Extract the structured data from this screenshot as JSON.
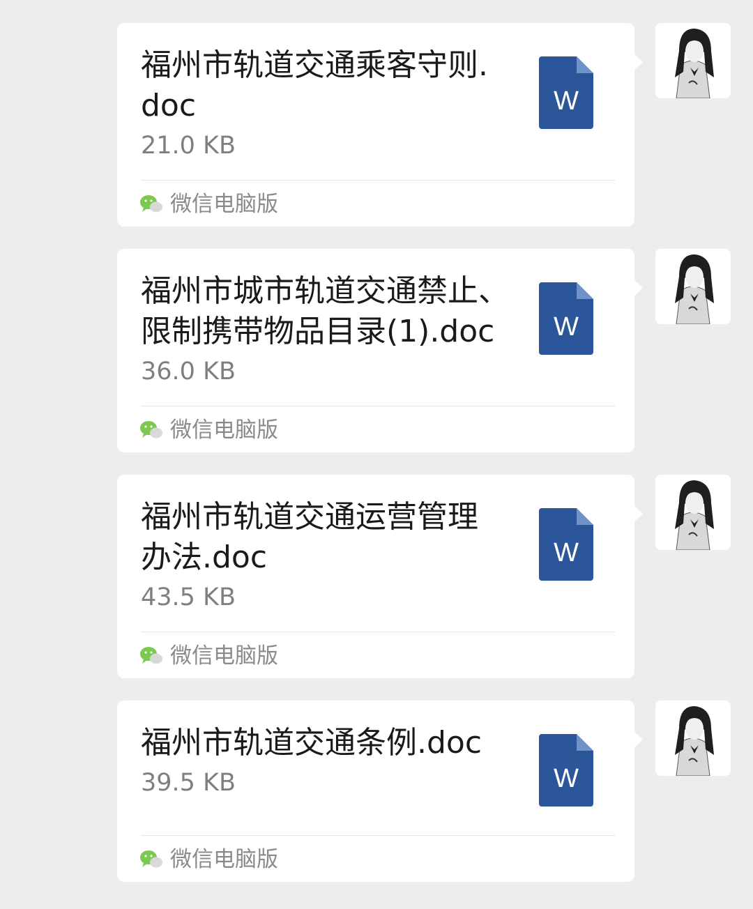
{
  "messages": [
    {
      "file_name": "福州市轨道交通乘客守则.\ndoc",
      "file_size": "21.0 KB",
      "icon_letter": "W",
      "source": "微信电脑版"
    },
    {
      "file_name": "福州市城市轨道交通禁止、\n限制携带物品目录(1).doc",
      "file_size": "36.0 KB",
      "icon_letter": "W",
      "source": "微信电脑版"
    },
    {
      "file_name": "福州市轨道交通运营管理\n办法.doc",
      "file_size": "43.5 KB",
      "icon_letter": "W",
      "source": "微信电脑版"
    },
    {
      "file_name": "福州市轨道交通条例.doc",
      "file_size": "39.5 KB",
      "icon_letter": "W",
      "source": "微信电脑版"
    }
  ],
  "icons": {
    "file": "word-doc-icon",
    "source": "wechat-icon",
    "avatar": "user-avatar"
  },
  "colors": {
    "background": "#ededed",
    "bubble": "#ffffff",
    "word_blue": "#2b579a",
    "wechat_green": "#7bc950"
  }
}
